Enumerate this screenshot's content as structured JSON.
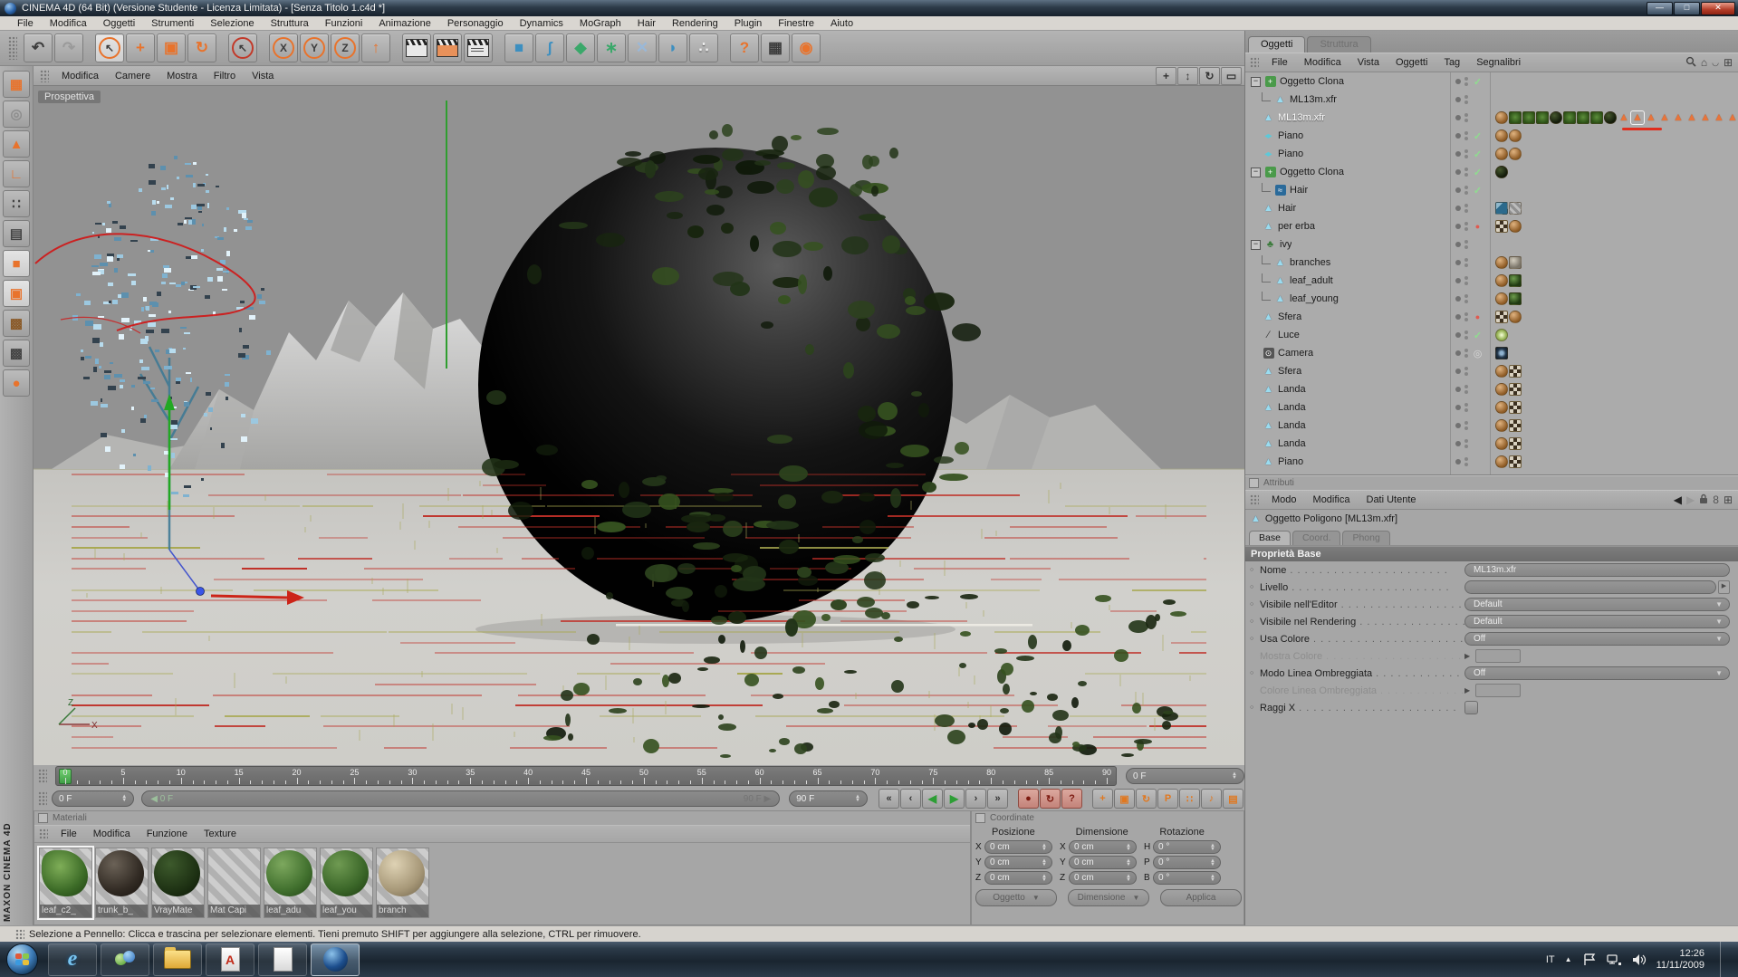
{
  "window": {
    "title": "CINEMA 4D (64 Bit) (Versione Studente - Licenza Limitata) - [Senza Titolo 1.c4d *]",
    "controls": [
      "minimize",
      "maximize",
      "close"
    ]
  },
  "colors": {
    "accent_orange": "#e8732c",
    "check_green": "#8fdc8f",
    "record_red": "#c23a2a",
    "playhead_green": "#55c060",
    "viewport_bg": "#8f8f8f",
    "ground": "#cac9c5",
    "panel_bg": "#a6a6a6"
  },
  "menubar": [
    "File",
    "Modifica",
    "Oggetti",
    "Strumenti",
    "Selezione",
    "Struttura",
    "Funzioni",
    "Animazione",
    "Personaggio",
    "Dynamics",
    "MoGraph",
    "Hair",
    "Rendering",
    "Plugin",
    "Finestre",
    "Aiuto"
  ],
  "toolbar": [
    {
      "name": "undo-button",
      "glyph": "↶",
      "style": "plain"
    },
    {
      "name": "redo-button",
      "glyph": "↷",
      "style": "disabled"
    },
    {
      "name": "sep"
    },
    {
      "name": "live-selection-tool",
      "glyph": "↖",
      "style": "ring-active"
    },
    {
      "name": "move-tool",
      "glyph": "+",
      "style": "orange"
    },
    {
      "name": "scale-tool",
      "glyph": "▣",
      "style": "orange"
    },
    {
      "name": "rotate-tool",
      "glyph": "↻",
      "style": "orange"
    },
    {
      "name": "sep"
    },
    {
      "name": "last-tool",
      "glyph": "↖",
      "style": "ring-red"
    },
    {
      "name": "sep"
    },
    {
      "name": "lock-x-axis",
      "glyph": "X",
      "style": "ring"
    },
    {
      "name": "lock-y-axis",
      "glyph": "Y",
      "style": "ring"
    },
    {
      "name": "lock-z-axis",
      "glyph": "Z",
      "style": "ring"
    },
    {
      "name": "coordinate-system",
      "glyph": "↑",
      "style": "orange"
    },
    {
      "name": "sep"
    },
    {
      "name": "render-view-button",
      "glyph": "",
      "style": "clapper"
    },
    {
      "name": "render-active-button",
      "glyph": "",
      "style": "clapper orange"
    },
    {
      "name": "render-settings-button",
      "glyph": "",
      "style": "clapper list"
    },
    {
      "name": "sep"
    },
    {
      "name": "add-cube-primitive",
      "glyph": "■",
      "style": "blue"
    },
    {
      "name": "add-spline",
      "glyph": "ʃ",
      "style": "blue"
    },
    {
      "name": "add-generator",
      "glyph": "◆",
      "style": "green"
    },
    {
      "name": "add-modeling-object",
      "glyph": "∗",
      "style": "green"
    },
    {
      "name": "add-deformer",
      "glyph": "✕",
      "style": "lightblue"
    },
    {
      "name": "add-nurbs",
      "glyph": "◗",
      "style": "blue"
    },
    {
      "name": "add-particles",
      "glyph": "∴",
      "style": "white"
    },
    {
      "name": "sep"
    },
    {
      "name": "help-button",
      "glyph": "?",
      "style": "orange"
    },
    {
      "name": "xpresso-button",
      "glyph": "▦",
      "style": "plain"
    },
    {
      "name": "browser-button",
      "glyph": "◉",
      "style": "orange"
    }
  ],
  "left_toolbar": [
    {
      "name": "make-editable-button",
      "glyph": "▦",
      "style": "orange"
    },
    {
      "name": "model-mode-button",
      "glyph": "◎",
      "style": "disabled"
    },
    {
      "name": "object-mode-button",
      "glyph": "▲",
      "style": "orange"
    },
    {
      "name": "axis-mode-button",
      "glyph": "∟",
      "style": "orange"
    },
    {
      "name": "points-mode-button",
      "glyph": "∷",
      "style": "plain"
    },
    {
      "name": "edge-mode-button",
      "glyph": "▤",
      "style": "plain"
    },
    {
      "name": "polygon-mode-button",
      "glyph": "■",
      "style": "orange-active"
    },
    {
      "name": "uv-polygon-mode-button",
      "glyph": "▣",
      "style": "orange-active"
    },
    {
      "name": "texture-mode-button",
      "glyph": "▩",
      "style": "brown"
    },
    {
      "name": "texture-axis-mode-button",
      "glyph": "▩",
      "style": "plain"
    },
    {
      "name": "object-library-button",
      "glyph": "●",
      "style": "orange"
    }
  ],
  "viewport": {
    "menu": [
      "Modifica",
      "Camere",
      "Mostra",
      "Filtro",
      "Vista"
    ],
    "label": "Prospettiva",
    "nav_icons": [
      {
        "name": "viewport-pan-icon",
        "glyph": "+"
      },
      {
        "name": "viewport-zoom-icon",
        "glyph": "↕"
      },
      {
        "name": "viewport-rotate-icon",
        "glyph": "↻"
      },
      {
        "name": "viewport-maximize-icon",
        "glyph": "▭"
      }
    ],
    "axis_labels": {
      "x": "X",
      "z": "Z"
    }
  },
  "timeline": {
    "tick_start": 0,
    "tick_end": 90,
    "tick_step": 5,
    "ruler_spinner": "0 F",
    "current_frame": "0 F",
    "slider_left": "0 F",
    "slider_right": "90 F",
    "range_end": "90 F",
    "playback": [
      {
        "name": "goto-start-button",
        "glyph": "«"
      },
      {
        "name": "previous-frame-button",
        "glyph": "‹"
      },
      {
        "name": "play-backward-button",
        "glyph": "◀",
        "play": true
      },
      {
        "name": "play-forward-button",
        "glyph": "▶",
        "play": true
      },
      {
        "name": "next-frame-button",
        "glyph": "›"
      },
      {
        "name": "goto-end-button",
        "glyph": "»"
      }
    ],
    "record": [
      {
        "name": "record-keyframe-button",
        "glyph": "●"
      },
      {
        "name": "autokey-button",
        "glyph": "↻"
      },
      {
        "name": "keying-options-button",
        "glyph": "?"
      }
    ],
    "toggles": [
      {
        "name": "record-position-toggle",
        "glyph": "+"
      },
      {
        "name": "record-scale-toggle",
        "glyph": "▣"
      },
      {
        "name": "record-rotation-toggle",
        "glyph": "↻"
      },
      {
        "name": "record-parameter-toggle",
        "glyph": "P"
      },
      {
        "name": "record-pla-toggle",
        "glyph": "∷"
      },
      {
        "name": "sound-toggle",
        "glyph": "♪"
      },
      {
        "name": "keyframe-selection-toggle",
        "glyph": "▤"
      }
    ]
  },
  "materials": {
    "title": "Materiali",
    "menu": [
      "File",
      "Modifica",
      "Funzione",
      "Texture"
    ],
    "items": [
      {
        "label": "leaf_c2_",
        "style": "leaf",
        "selected": true
      },
      {
        "label": "trunk_b_",
        "style": "bark",
        "selected": false
      },
      {
        "label": "VrayMate",
        "style": "vray",
        "selected": false
      },
      {
        "label": "Mat Capi",
        "style": "flat",
        "selected": false
      },
      {
        "label": "leaf_adu",
        "style": "leafA",
        "selected": false
      },
      {
        "label": "leaf_you",
        "style": "leafY",
        "selected": false
      },
      {
        "label": "branch",
        "style": "branch",
        "selected": false
      }
    ]
  },
  "coordinates": {
    "title": "Coordinate",
    "columns": [
      "Posizione",
      "Dimensione",
      "Rotazione"
    ],
    "rows": [
      [
        {
          "axis": "X",
          "value": "0 cm"
        },
        {
          "axis": "X",
          "value": "0 cm"
        },
        {
          "axis": "H",
          "value": "0 °"
        }
      ],
      [
        {
          "axis": "Y",
          "value": "0 cm"
        },
        {
          "axis": "Y",
          "value": "0 cm"
        },
        {
          "axis": "P",
          "value": "0 °"
        }
      ],
      [
        {
          "axis": "Z",
          "value": "0 cm"
        },
        {
          "axis": "Z",
          "value": "0 cm"
        },
        {
          "axis": "B",
          "value": "0 °"
        }
      ]
    ],
    "buttons": [
      {
        "label": "Oggetto",
        "name": "position-mode-dropdown",
        "dropdown": true
      },
      {
        "label": "Dimensione",
        "name": "size-mode-dropdown",
        "dropdown": true
      },
      {
        "label": "Applica",
        "name": "apply-button",
        "dropdown": false
      }
    ]
  },
  "object_manager": {
    "tabs": [
      {
        "label": "Oggetti",
        "active": true
      },
      {
        "label": "Struttura",
        "active": false
      }
    ],
    "menu": [
      "File",
      "Modifica",
      "Vista",
      "Oggetti",
      "Tag",
      "Segnalibri"
    ],
    "icons": [
      "search-icon",
      "bookmark-icon",
      "collapse-icon",
      "new-panel-icon"
    ],
    "tree": [
      {
        "name": "Oggetto Clona",
        "icon": "clone",
        "depth": 0,
        "expander": true,
        "state": "check",
        "selected": false,
        "tags": []
      },
      {
        "name": "ML13m.xfr",
        "icon": "poly",
        "depth": 1,
        "expander": false,
        "state": null,
        "selected": false,
        "tags": []
      },
      {
        "name": "ML13m.xfr",
        "icon": "poly",
        "depth": 0,
        "expander": false,
        "state": null,
        "selected": true,
        "tags": [
          "brown",
          "tree",
          "tree",
          "tree",
          "darkball",
          "tree",
          "tree",
          "tree",
          "darkball",
          "tri",
          "tri-active",
          "tri",
          "tri",
          "tri",
          "tri",
          "tri",
          "tri",
          "tri",
          "checker"
        ]
      },
      {
        "name": "Piano",
        "icon": "plane",
        "depth": 0,
        "expander": false,
        "state": "check",
        "selected": false,
        "tags": [
          "brown",
          "brown"
        ]
      },
      {
        "name": "Piano",
        "icon": "plane",
        "depth": 0,
        "expander": false,
        "state": "check",
        "selected": false,
        "tags": [
          "brown",
          "brown"
        ]
      },
      {
        "name": "Oggetto Clona",
        "icon": "clone",
        "depth": 0,
        "expander": true,
        "state": "check",
        "selected": false,
        "tags": [
          "darkball"
        ]
      },
      {
        "name": "Hair",
        "icon": "hairobj",
        "depth": 1,
        "expander": false,
        "state": "check",
        "selected": false,
        "tags": []
      },
      {
        "name": "Hair",
        "icon": "poly",
        "depth": 0,
        "expander": false,
        "state": null,
        "selected": false,
        "tags": [
          "hairbrush",
          "stripes"
        ]
      },
      {
        "name": "per erba",
        "icon": "poly",
        "depth": 0,
        "expander": false,
        "state": "red",
        "selected": false,
        "tags": [
          "checker",
          "brown"
        ]
      },
      {
        "name": "ivy",
        "icon": "ivy",
        "depth": 0,
        "expander": true,
        "state": null,
        "selected": false,
        "tags": []
      },
      {
        "name": "branches",
        "icon": "poly",
        "depth": 1,
        "expander": false,
        "state": null,
        "selected": false,
        "tags": [
          "brown",
          "stone"
        ]
      },
      {
        "name": "leaf_adult",
        "icon": "poly",
        "depth": 1,
        "expander": false,
        "state": null,
        "selected": false,
        "tags": [
          "brown",
          "leafdark"
        ]
      },
      {
        "name": "leaf_young",
        "icon": "poly",
        "depth": 1,
        "expander": false,
        "state": null,
        "selected": false,
        "tags": [
          "brown",
          "leafdark"
        ]
      },
      {
        "name": "Sfera",
        "icon": "poly",
        "depth": 0,
        "expander": false,
        "state": "red",
        "selected": false,
        "tags": [
          "checker",
          "brown"
        ]
      },
      {
        "name": "Luce",
        "icon": "light",
        "depth": 0,
        "expander": false,
        "state": "check",
        "selected": false,
        "tags": [
          "light"
        ]
      },
      {
        "name": "Camera",
        "icon": "camera",
        "depth": 0,
        "expander": false,
        "state": "target",
        "selected": false,
        "tags": [
          "camlens"
        ]
      },
      {
        "name": "Sfera",
        "icon": "poly",
        "depth": 0,
        "expander": false,
        "state": null,
        "selected": false,
        "tags": [
          "brown",
          "checker"
        ]
      },
      {
        "name": "Landa",
        "icon": "poly",
        "depth": 0,
        "expander": false,
        "state": null,
        "selected": false,
        "tags": [
          "brown",
          "checker"
        ]
      },
      {
        "name": "Landa",
        "icon": "poly",
        "depth": 0,
        "expander": false,
        "state": null,
        "selected": false,
        "tags": [
          "brown",
          "checker"
        ]
      },
      {
        "name": "Landa",
        "icon": "poly",
        "depth": 0,
        "expander": false,
        "state": null,
        "selected": false,
        "tags": [
          "brown",
          "checker"
        ]
      },
      {
        "name": "Landa",
        "icon": "poly",
        "depth": 0,
        "expander": false,
        "state": null,
        "selected": false,
        "tags": [
          "brown",
          "checker"
        ]
      },
      {
        "name": "Piano",
        "icon": "poly",
        "depth": 0,
        "expander": false,
        "state": null,
        "selected": false,
        "tags": [
          "brown",
          "checker"
        ]
      }
    ]
  },
  "attributes": {
    "title": "Attributi",
    "menu": [
      "Modo",
      "Modifica",
      "Dati Utente"
    ],
    "icons": [
      "history-back-icon",
      "history-forward-icon",
      "lock-icon",
      "link-icon",
      "new-panel-icon"
    ],
    "object_header": "Oggetto Poligono [ML13m.xfr]",
    "tabs": [
      {
        "label": "Base",
        "active": true
      },
      {
        "label": "Coord.",
        "active": false
      },
      {
        "label": "Phong",
        "active": false
      }
    ],
    "section": "Proprietà Base",
    "fields": [
      {
        "label": "Nome",
        "type": "text",
        "value": "ML13m.xfr",
        "disabled": false
      },
      {
        "label": "Livello",
        "type": "bar",
        "value": "",
        "disabled": false
      },
      {
        "label": "Visibile nell'Editor",
        "type": "dropdown",
        "value": "Default",
        "disabled": false
      },
      {
        "label": "Visibile nel Rendering",
        "type": "dropdown",
        "value": "Default",
        "disabled": false
      },
      {
        "label": "Usa Colore",
        "type": "dropdown",
        "value": "Off",
        "disabled": false
      },
      {
        "label": "Mostra Colore",
        "type": "colorbox",
        "value": "",
        "disabled": true
      },
      {
        "label": "Modo Linea Ombreggiata",
        "type": "dropdown",
        "value": "Off",
        "disabled": false
      },
      {
        "label": "Colore Linea Ombreggiata",
        "type": "colorbox",
        "value": "",
        "disabled": true
      },
      {
        "label": "Raggi X",
        "type": "checkbox",
        "value": "",
        "disabled": false
      }
    ]
  },
  "statusbar": {
    "text": "Selezione a Pennello: Clicca e trascina per selezionare elementi. Tieni premuto SHIFT per aggiungere alla selezione, CTRL per rimuovere."
  },
  "branding": {
    "vertical_label": "MAXON  CINEMA 4D"
  },
  "taskbar": {
    "apps": [
      {
        "name": "taskbar-internet-explorer",
        "active": false
      },
      {
        "name": "taskbar-messenger",
        "active": false
      },
      {
        "name": "taskbar-explorer",
        "active": false
      },
      {
        "name": "taskbar-autocad",
        "active": false
      },
      {
        "name": "taskbar-notepad",
        "active": false
      },
      {
        "name": "taskbar-cinema4d",
        "active": true
      }
    ],
    "tray": {
      "language": "IT",
      "time": "12:26",
      "date": "11/11/2009"
    }
  }
}
